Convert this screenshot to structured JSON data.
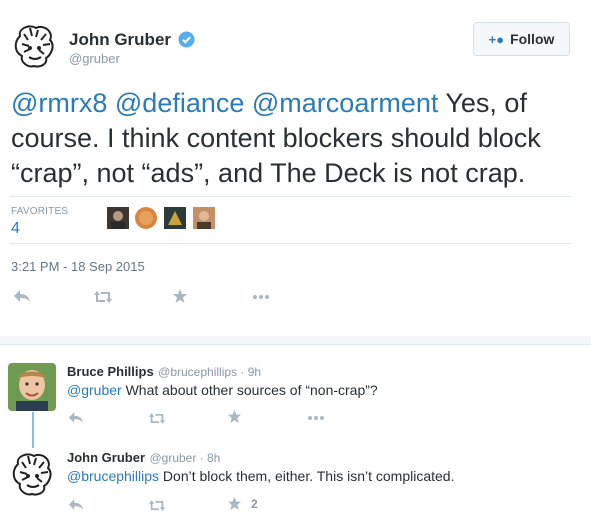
{
  "tweet": {
    "name": "John Gruber",
    "handle": "@gruber",
    "follow_label": "Follow",
    "text_mentions": "@rmrx8 @defiance @marcoarment",
    "text_body": " Yes, of course. I think content blockers should block “crap”, not “ads”, and The Deck is not crap.",
    "favorites_label": "FAVORITES",
    "favorites_count": "4",
    "timestamp": "3:21 PM - 18 Sep 2015"
  },
  "replies": [
    {
      "name": "Bruce Phillips",
      "handle": "@brucephillips · 9h",
      "mention": "@gruber",
      "text": " What about other sources of “non-crap”?",
      "favorites": ""
    },
    {
      "name": "John Gruber",
      "handle": "@gruber · 8h",
      "mention": "@brucephillips",
      "text": " Don’t block them, either. This isn’t complicated.",
      "favorites": "2"
    }
  ],
  "icons": {
    "reply": "reply-icon",
    "retweet": "retweet-icon",
    "favorite": "star-icon",
    "more": "more-icon",
    "verified": "verified-badge-icon",
    "follow": "add-user-icon"
  },
  "colors": {
    "link": "#2b7bb9",
    "muted": "#8899a6",
    "icon": "#aab8c2",
    "thread": "#7fc1e9"
  }
}
